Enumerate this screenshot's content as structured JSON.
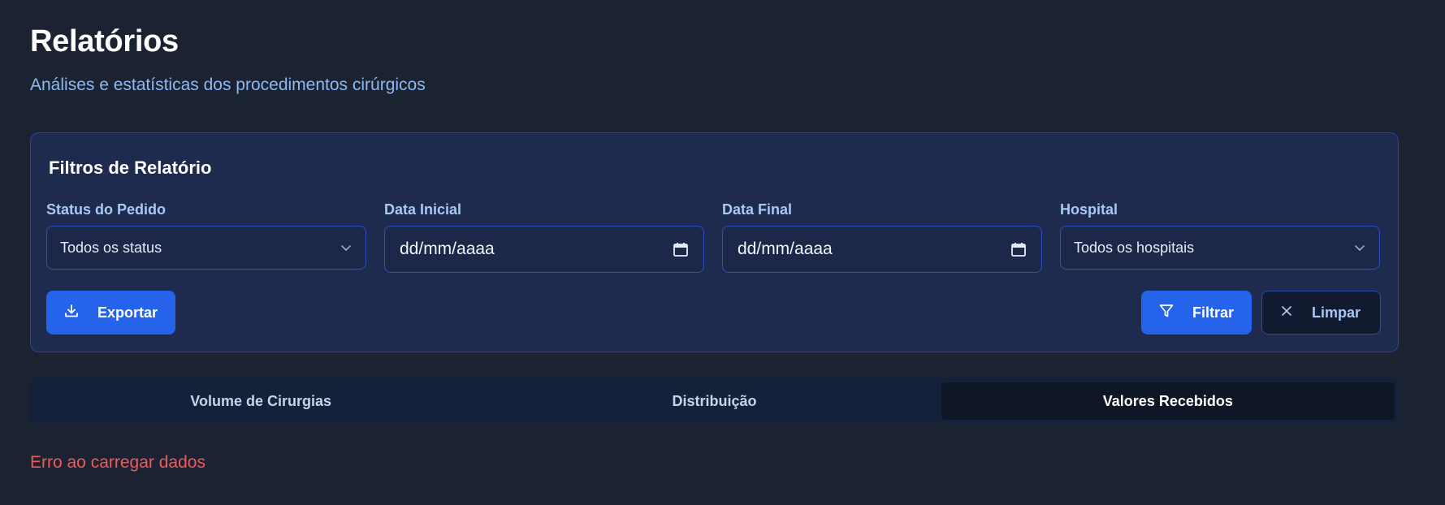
{
  "header": {
    "title": "Relatórios",
    "subtitle": "Análises e estatísticas dos procedimentos cirúrgicos"
  },
  "filters": {
    "title": "Filtros de Relatório",
    "status": {
      "label": "Status do Pedido",
      "value": "Todos os status",
      "icon": "chevron-down-icon"
    },
    "start_date": {
      "label": "Data Inicial",
      "value": "dd/mm/aaaa",
      "icon": "calendar-icon"
    },
    "end_date": {
      "label": "Data Final",
      "value": "dd/mm/aaaa",
      "icon": "calendar-icon"
    },
    "hospital": {
      "label": "Hospital",
      "value": "Todos os hospitais",
      "icon": "chevron-down-icon"
    },
    "export_button": {
      "label": "Exportar",
      "icon": "download-icon"
    },
    "filter_button": {
      "label": "Filtrar",
      "icon": "filter-icon"
    },
    "clear_button": {
      "label": "Limpar",
      "icon": "close-icon"
    }
  },
  "tabs": [
    {
      "label": "Volume de Cirurgias",
      "active": false
    },
    {
      "label": "Distribuição",
      "active": false
    },
    {
      "label": "Valores Recebidos",
      "active": true
    }
  ],
  "status": {
    "error": "Erro ao carregar dados"
  },
  "colors": {
    "background": "#1b2332",
    "card": "#1f2b4e",
    "accent": "#2563eb",
    "label": "#a9c8f5",
    "error": "#ef5b5b"
  }
}
